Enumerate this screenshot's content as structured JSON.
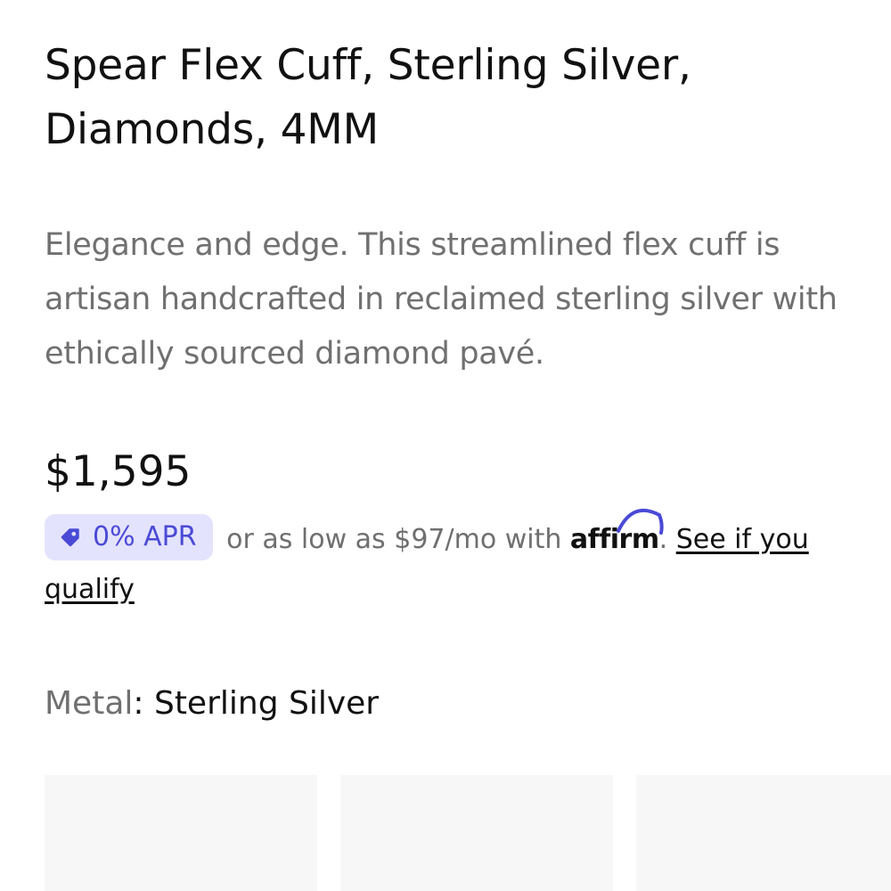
{
  "product": {
    "title": "Spear Flex Cuff, Sterling Silver, Diamonds, 4MM",
    "description": "Elegance and edge. This streamlined flex cuff is artisan handcrafted in reclaimed sterling silver with ethically sourced diamond pavé.",
    "price": "$1,595"
  },
  "financing": {
    "badge_icon": "tag-icon",
    "badge_label": "0% APR",
    "text_before": "or as low as $97/mo with",
    "provider": "affirm",
    "text_after": ".",
    "link_label": "See if you qualify",
    "badge_color": "#4a4ad6",
    "badge_bg": "#e4e3fd",
    "logo_arc_color": "#4a4ad6"
  },
  "metal": {
    "label": "Metal",
    "separator": ": ",
    "value": "Sterling Silver"
  },
  "swatches": [
    {
      "name": "swatch-1"
    },
    {
      "name": "swatch-2"
    },
    {
      "name": "swatch-3"
    }
  ]
}
